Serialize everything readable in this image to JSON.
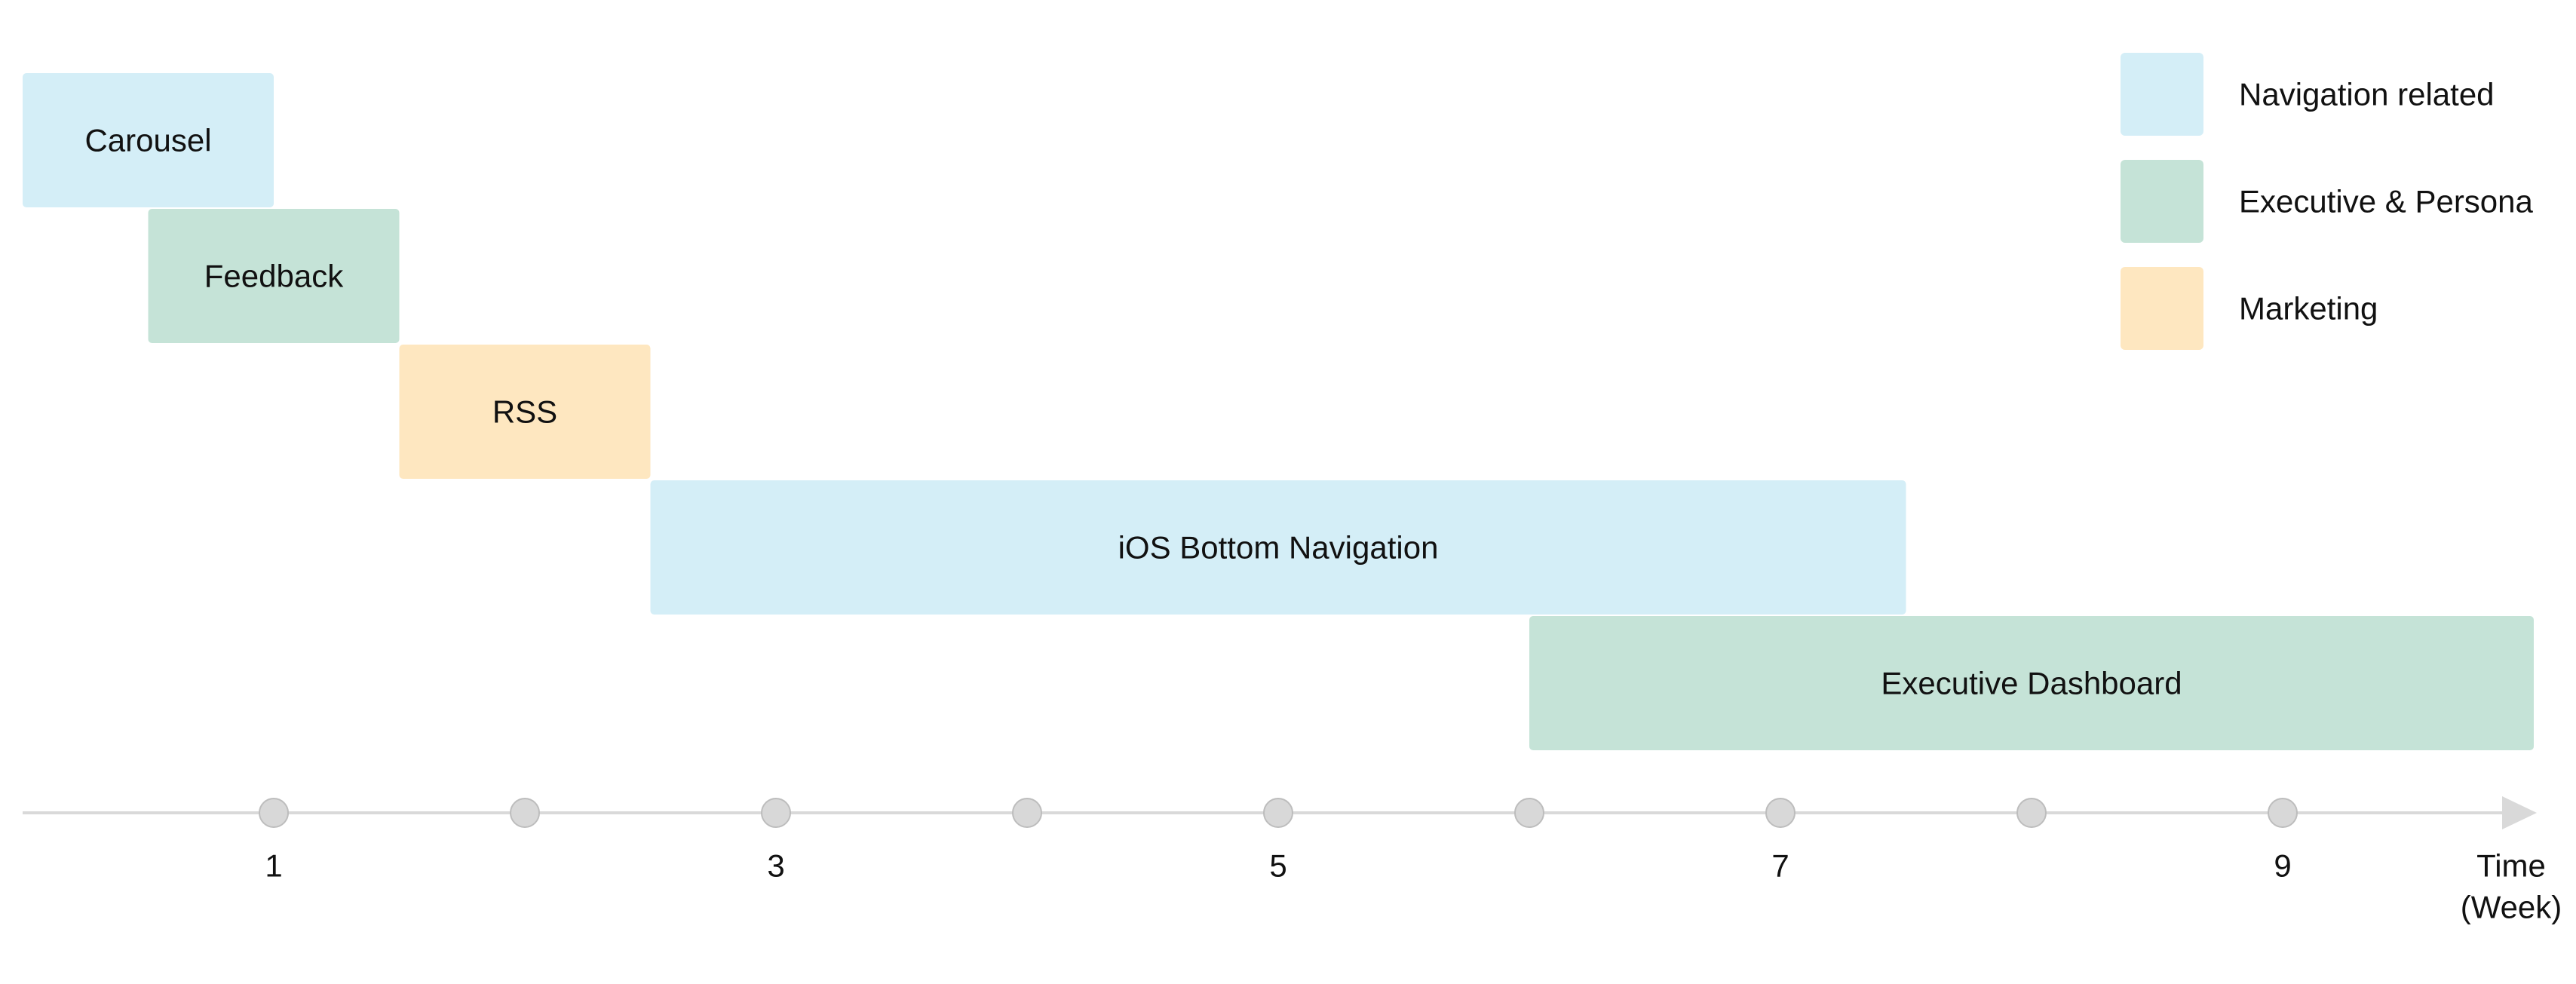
{
  "chart_data": {
    "type": "bar",
    "subtype": "gantt-timeline",
    "xlabel": [
      "Time",
      "(Week)"
    ],
    "x_ticks": [
      1,
      3,
      5,
      7,
      9
    ],
    "x_markers": [
      1,
      2,
      3,
      4,
      5,
      6,
      7,
      8,
      9
    ],
    "xlim": [
      0,
      10
    ],
    "grid": false,
    "legend_position": "top-right",
    "categories_legend": [
      {
        "name": "Navigation related",
        "color": "#d4eef7"
      },
      {
        "name": "Executive & Persona",
        "color": "#c5e3d7"
      },
      {
        "name": "Marketing",
        "color": "#fee7c0"
      }
    ],
    "tasks": [
      {
        "name": "Carousel",
        "start": 0,
        "end": 1,
        "category": "Navigation related"
      },
      {
        "name": "Feedback",
        "start": 0.5,
        "end": 1.5,
        "category": "Executive & Persona"
      },
      {
        "name": "RSS",
        "start": 1.5,
        "end": 2.5,
        "category": "Marketing"
      },
      {
        "name": "iOS Bottom Navigation",
        "start": 2.5,
        "end": 7.5,
        "category": "Navigation related"
      },
      {
        "name": "Executive Dashboard",
        "start": 6,
        "end": 10,
        "category": "Executive & Persona"
      }
    ]
  },
  "colors": {
    "axis_line": "#d9d9d9",
    "marker_fill": "#d8d8d8",
    "marker_stroke": "#bdbdbd",
    "text": "#111111"
  }
}
